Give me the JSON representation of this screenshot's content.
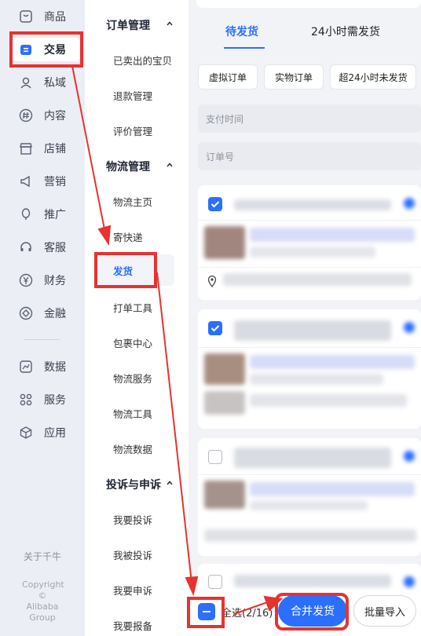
{
  "nav": {
    "items": [
      {
        "label": "商品",
        "icon": "product-icon"
      },
      {
        "label": "交易",
        "icon": "trade-icon"
      },
      {
        "label": "私域",
        "icon": "people-icon"
      },
      {
        "label": "内容",
        "icon": "hashtag-icon"
      },
      {
        "label": "店铺",
        "icon": "store-icon"
      },
      {
        "label": "营销",
        "icon": "megaphone-icon"
      },
      {
        "label": "推广",
        "icon": "balloon-icon"
      },
      {
        "label": "客服",
        "icon": "headset-icon"
      },
      {
        "label": "财务",
        "icon": "yen-icon"
      },
      {
        "label": "金融",
        "icon": "diamond-icon"
      },
      {
        "label": "数据",
        "icon": "chart-icon"
      },
      {
        "label": "服务",
        "icon": "grid-icon"
      },
      {
        "label": "应用",
        "icon": "cube-icon"
      }
    ],
    "about": "关于千牛",
    "copyright": [
      "Copyright",
      "© Alibaba",
      "Group"
    ]
  },
  "subnav": {
    "sections": [
      {
        "title": "订单管理",
        "items": [
          "已卖出的宝贝",
          "退款管理",
          "评价管理"
        ]
      },
      {
        "title": "物流管理",
        "items": [
          "物流主页",
          "寄快递",
          "发货",
          "打单工具",
          "包裹中心",
          "物流服务",
          "物流工具",
          "物流数据"
        ]
      },
      {
        "title": "投诉与申诉",
        "items": [
          "我要投诉",
          "我被投诉",
          "我要申诉",
          "我要报备"
        ]
      }
    ]
  },
  "main": {
    "tabs": [
      "待发货",
      "24小时需发货"
    ],
    "chips": [
      "虚拟订单",
      "实物订单",
      "超24小时未发货"
    ],
    "filters": {
      "pay_time": "支付时间",
      "order_no": "订单号"
    }
  },
  "bottom": {
    "select_all_label": "全选(2/16)",
    "merge_button": "合并发货",
    "batch_button": "批量导入"
  },
  "colors": {
    "accent": "#2a6fff",
    "highlight": "#e8322f"
  }
}
